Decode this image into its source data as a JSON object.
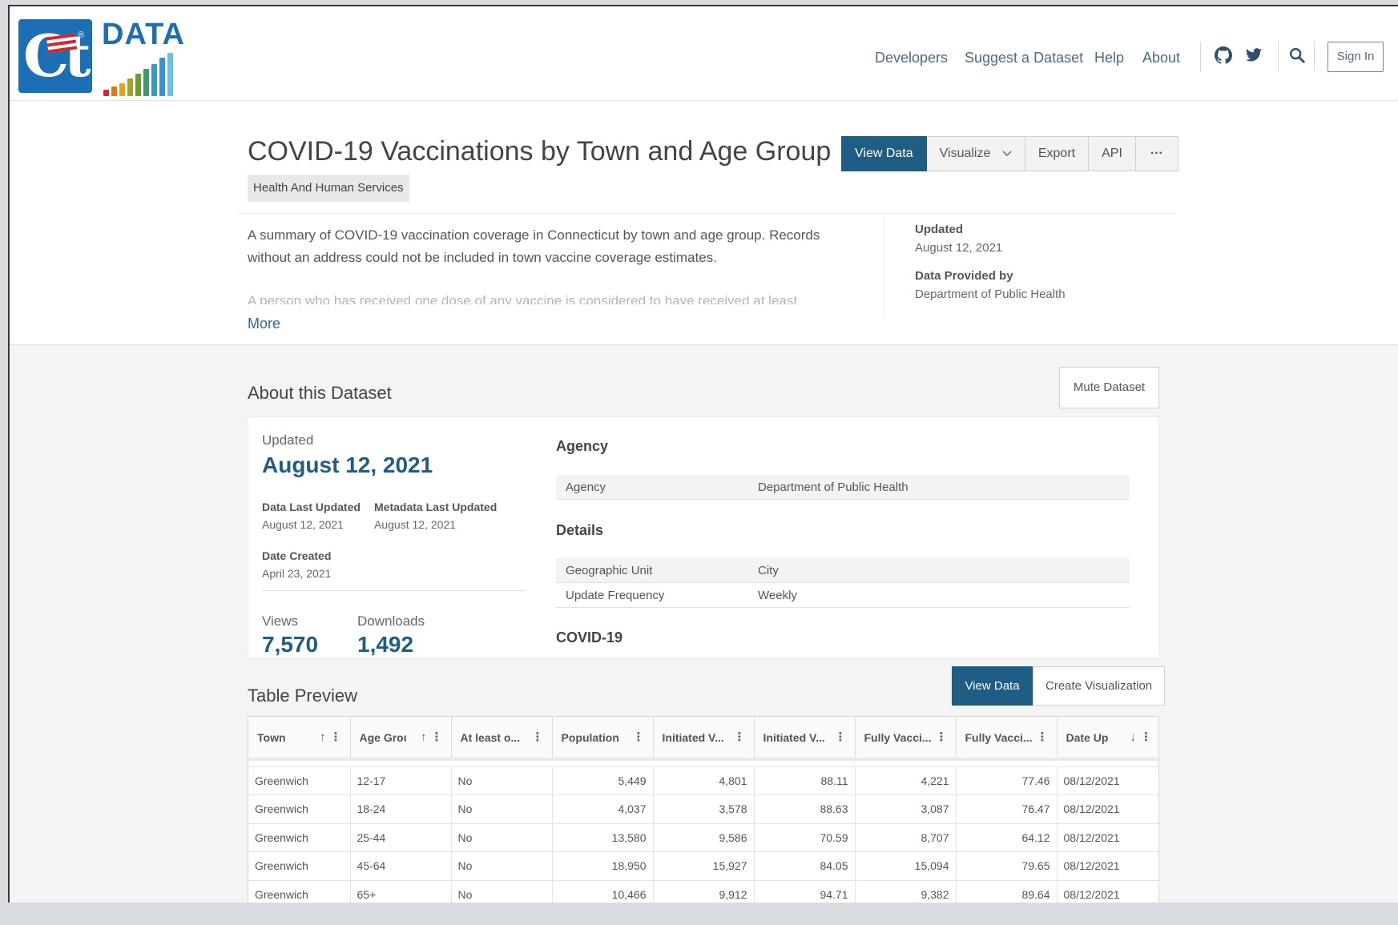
{
  "header": {
    "logo_ct": "Ct",
    "logo_reg": "®",
    "logo_text": "DATA",
    "nav": [
      "Developers",
      "Suggest a Dataset",
      "Help",
      "About"
    ],
    "sign_in": "Sign In",
    "icons": [
      "github-icon",
      "twitter-icon",
      "search-icon"
    ]
  },
  "dataset": {
    "title": "COVID-19 Vaccinations by Town and Age Group",
    "category": "Health And Human Services",
    "buttons": {
      "view_data": "View Data",
      "visualize": "Visualize",
      "export": "Export",
      "api": "API",
      "more": "···"
    },
    "description": "A summary of COVID-19 vaccination coverage in Connecticut by town and age group. Records without an address could not be included in town vaccine coverage estimates.",
    "description_faded": "A person who has received one dose of any vaccine is considered to have received at least",
    "more_link": "More",
    "side": {
      "updated_label": "Updated",
      "updated_value": "August 12, 2021",
      "provided_label": "Data Provided by",
      "provided_value": "Department of Public Health"
    }
  },
  "about": {
    "heading": "About this Dataset",
    "mute": "Mute Dataset",
    "updated_label": "Updated",
    "updated_value": "August 12, 2021",
    "data_last_updated_label": "Data Last Updated",
    "data_last_updated_value": "August 12, 2021",
    "metadata_last_updated_label": "Metadata Last Updated",
    "metadata_last_updated_value": "August 12, 2021",
    "date_created_label": "Date Created",
    "date_created_value": "April 23, 2021",
    "views_label": "Views",
    "views_value": "7,570",
    "downloads_label": "Downloads",
    "downloads_value": "1,492",
    "agency_title": "Agency",
    "agency_key": "Agency",
    "agency_value": "Department of Public Health",
    "details_title": "Details",
    "geo_key": "Geographic Unit",
    "geo_value": "City",
    "freq_key": "Update Frequency",
    "freq_value": "Weekly",
    "covid_title": "COVID-19"
  },
  "table_preview": {
    "heading": "Table Preview",
    "view_data": "View Data",
    "create_viz": "Create Visualization",
    "columns": [
      "Town",
      "Age Grou",
      "At least o...",
      "Population",
      "Initiated V...",
      "Initiated V...",
      "Fully Vacci...",
      "Fully Vacci...",
      "Date Up"
    ],
    "rows": [
      [
        "Greenwich",
        "12-17",
        "No",
        "5,449",
        "4,801",
        "88.11",
        "4,221",
        "77.46",
        "08/12/2021"
      ],
      [
        "Greenwich",
        "18-24",
        "No",
        "4,037",
        "3,578",
        "88.63",
        "3,087",
        "76.47",
        "08/12/2021"
      ],
      [
        "Greenwich",
        "25-44",
        "No",
        "13,580",
        "9,586",
        "70.59",
        "8,707",
        "64.12",
        "08/12/2021"
      ],
      [
        "Greenwich",
        "45-64",
        "No",
        "18,950",
        "15,927",
        "84.05",
        "15,094",
        "79.65",
        "08/12/2021"
      ],
      [
        "Greenwich",
        "65+",
        "No",
        "10,466",
        "9,912",
        "94.71",
        "9,382",
        "89.64",
        "08/12/2021"
      ]
    ]
  },
  "colors": {
    "primary": "#1f5d84",
    "logo_blue": "#1c6fb5",
    "link": "#4a6b8a"
  }
}
